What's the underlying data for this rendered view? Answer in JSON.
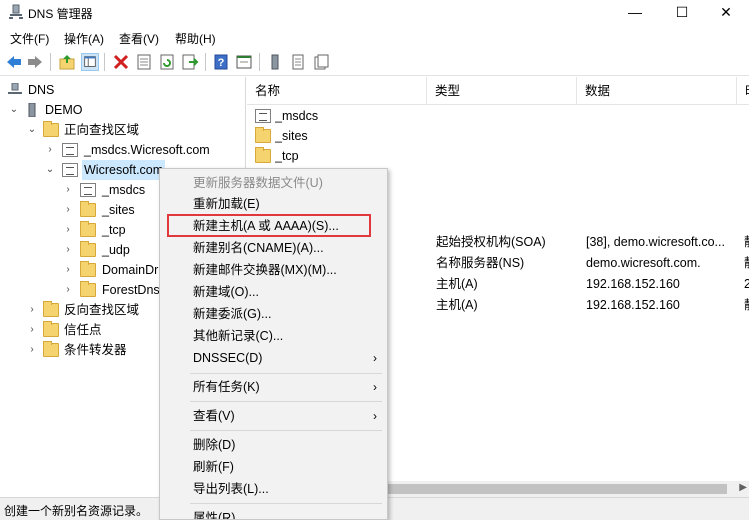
{
  "window": {
    "title": "DNS 管理器",
    "minimize": "—",
    "maximize": "☐",
    "close": "✕"
  },
  "menu": [
    "文件(F)",
    "操作(A)",
    "查看(V)",
    "帮助(H)"
  ],
  "toolbar_icons": [
    "back-arrow-icon",
    "forward-arrow-icon",
    "folder-up-icon",
    "show-hide-tree-icon",
    "delete-icon",
    "properties-icon",
    "refresh-icon",
    "export-icon",
    "help-icon",
    "details-icon",
    "server-icon",
    "records-icon",
    "zone-icon"
  ],
  "tree": {
    "root": "DNS",
    "server": "DEMO",
    "forward_zones": "正向查找区域",
    "msdcs_zone": "_msdcs.Wicresoft.com",
    "wicresoft_zone": "Wicresoft.com",
    "children": [
      "_msdcs",
      "_sites",
      "_tcp",
      "_udp",
      "DomainDr",
      "ForestDns"
    ],
    "reverse_zones": "反向查找区域",
    "trust_points": "信任点",
    "conditional_forwarders": "条件转发器"
  },
  "list": {
    "headers": [
      "名称",
      "类型",
      "数据",
      "时"
    ],
    "folder_rows": [
      "_msdcs",
      "_sites",
      "_tcp"
    ],
    "record_rows": [
      {
        "type": "起始授权机构(SOA)",
        "data": "[38], demo.wicresoft.co...",
        "ts": "静"
      },
      {
        "type": "名称服务器(NS)",
        "data": "demo.wicresoft.com.",
        "ts": "静"
      },
      {
        "type": "主机(A)",
        "data": "192.168.152.160",
        "ts": "2"
      },
      {
        "type": "主机(A)",
        "data": "192.168.152.160",
        "ts": "静"
      }
    ]
  },
  "context_menu": {
    "update_server_data": "更新服务器数据文件(U)",
    "reload": "重新加载(E)",
    "new_host": "新建主机(A 或 AAAA)(S)...",
    "new_alias": "新建别名(CNAME)(A)...",
    "new_mail_exchanger": "新建邮件交换器(MX)(M)...",
    "new_domain": "新建域(O)...",
    "new_delegation": "新建委派(G)...",
    "other_records": "其他新记录(C)...",
    "dnssec": "DNSSEC(D)",
    "all_tasks": "所有任务(K)",
    "view": "查看(V)",
    "delete": "删除(D)",
    "refresh": "刷新(F)",
    "export_list": "导出列表(L)...",
    "properties": "属性(R)",
    "submenu_arrow": "›"
  },
  "status": "创建一个新别名资源记录。",
  "colors": {
    "highlight_border": "#e0383c",
    "selection": "#cce8ff",
    "folder": "#f5d470"
  }
}
